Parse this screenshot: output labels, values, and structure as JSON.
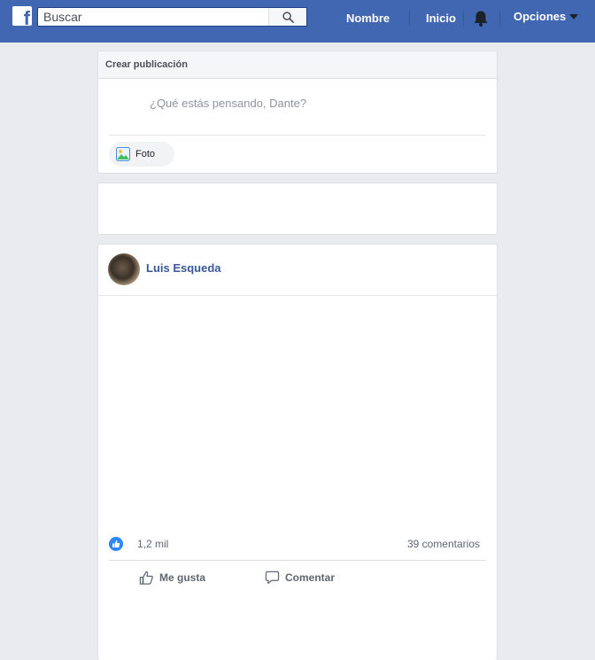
{
  "header": {
    "logo_letter": "f",
    "search": {
      "placeholder": "Buscar",
      "value": ""
    },
    "nav": {
      "profile": "Nombre",
      "home": "Inicio",
      "options": "Opciones"
    },
    "brand_color": "#4267b2"
  },
  "create_post": {
    "title": "Crear publicación",
    "prompt": "¿Qué estás pensando, Dante?",
    "photo_label": "Foto"
  },
  "post": {
    "author": "Luis Esqueda",
    "likes": "1,2 mil",
    "comments": "39 comentarios",
    "like_label": "Me gusta",
    "comment_label": "Comentar"
  },
  "icons": [
    "facebook-logo-icon",
    "search-icon",
    "bell-icon",
    "caret-down-icon",
    "photo-icon",
    "like-reaction-icon",
    "thumbs-up-icon",
    "comment-icon"
  ]
}
